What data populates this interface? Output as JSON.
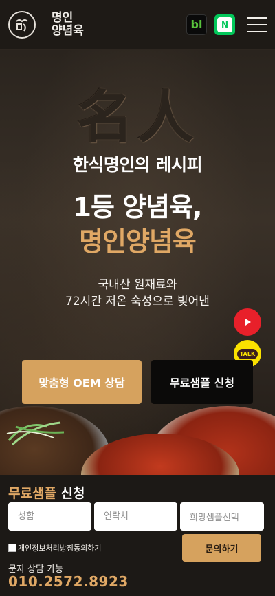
{
  "header": {
    "logo_line1": "명인",
    "logo_line2": "양념육",
    "badge_bl": "bl",
    "badge_n": "N"
  },
  "hero": {
    "hanja": "名人",
    "subtitle": "한식명인의 레시피",
    "headline_line1": "1등 양념육,",
    "headline_line2": "명인양념육",
    "desc_line1": "국내산 원재료와",
    "desc_line2": "72시간 저온 숙성으로 빚어낸",
    "cta_oem": "맞춤형 OEM 상담",
    "cta_sample": "무료샘플 신청",
    "talk_label": "TALK"
  },
  "form": {
    "title_gold": "무료샘플",
    "title_white": " 신청",
    "name_placeholder": "성함",
    "contact_placeholder": "연락처",
    "sample_select": "희망샘플선택",
    "consent_label": "개인정보처리방침동의하기",
    "submit_label": "문의하기",
    "sms_label": "문자 상담 가능",
    "phone": "010.2572.8923"
  },
  "colors": {
    "accent_gold": "#d6a25e",
    "text_gold": "#e0a865",
    "youtube_red": "#e8202a",
    "kakao_yellow": "#fae100",
    "naver_green": "#03c75a"
  },
  "icons": [
    "logo-emblem-icon",
    "blog-icon",
    "naver-icon",
    "menu-icon",
    "youtube-icon",
    "kakaotalk-icon"
  ]
}
